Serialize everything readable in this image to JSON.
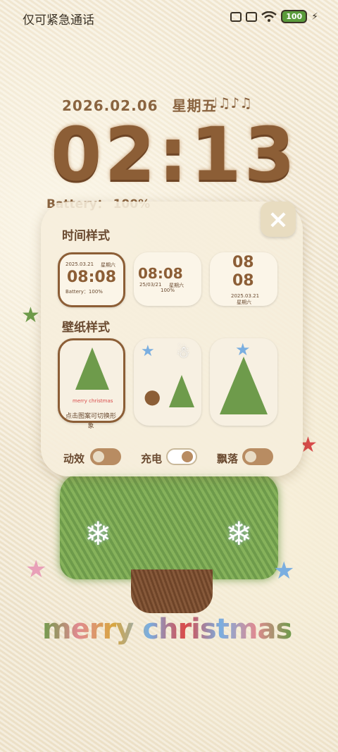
{
  "status": {
    "carrier": "仅可紧急通话",
    "battery": "100",
    "icons": [
      "vibrate-icon",
      "sim-off-icon",
      "wifi-icon",
      "battery-icon",
      "charging-icon"
    ]
  },
  "lockscreen": {
    "date": "2026.02.06",
    "weekday": "星期五",
    "notes": "♩♫♪♫",
    "time": "02:13",
    "battery_line": "Battery： 100%",
    "greeting": "merry christmas"
  },
  "panel": {
    "time_style_title": "时间样式",
    "wallpaper_style_title": "壁纸样式",
    "hint": "点击图案可切换形象",
    "close": "×",
    "time_styles": [
      {
        "date": "2025.03.21",
        "weekday": "星期六",
        "time": "08:08",
        "battery": "Battery：100%"
      },
      {
        "time": "08:08",
        "date": "25/03/21",
        "weekday": "星期六",
        "battery": "100%"
      },
      {
        "hour": "08",
        "minute": "08",
        "date": "2025.03.21",
        "weekday": "星期六"
      }
    ],
    "mini_greeting": "merry christmas",
    "toggles": [
      {
        "label": "动效",
        "state": "off"
      },
      {
        "label": "充电",
        "state": "on"
      },
      {
        "label": "飘落",
        "state": "off"
      }
    ]
  },
  "colors": {
    "brown": "#8c5e36",
    "green": "#6e9b4b",
    "cream": "#f5ecd8"
  }
}
